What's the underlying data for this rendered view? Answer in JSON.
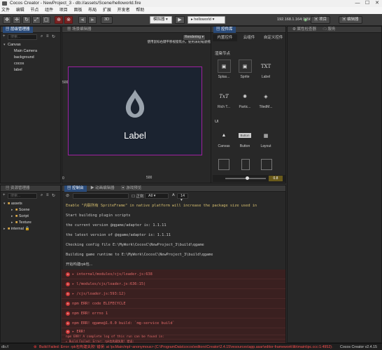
{
  "titlebar": {
    "title": "Cocos Creator - NewProject_3 - db://assets/Scene/helloworld.fire",
    "min": "—",
    "max": "☐",
    "close": "✕"
  },
  "menu": [
    "文件",
    "编辑",
    "节点",
    "组件",
    "项目",
    "面板",
    "布局",
    "扩展",
    "开发者",
    "帮助"
  ],
  "toolbar": {
    "preview_mode": "模拟器",
    "play": "▶",
    "scene_select": "helloworld",
    "ip": "192.168.1.164:7456",
    "project_btn": "项目",
    "editor_btn": "编辑器",
    "label_3d": "3D"
  },
  "hierarchy": {
    "title": "层级管理器",
    "search_placeholder": "搜索...",
    "root": "Canvas",
    "children": [
      "Main Camera",
      "background",
      "cocos",
      "label"
    ]
  },
  "scene": {
    "title": "场景编辑器",
    "hint": "使用鼠标右键平移视窗焦点，使用滚轮缩放视图",
    "label_text": "Label",
    "axis_500_top": "500",
    "axis_500_bottom": "500",
    "axis_0": "0",
    "rendering_btn": "Rendering ▾"
  },
  "controls": {
    "title": "控件库",
    "tabs": [
      "内置控件",
      "云组件",
      "自定义控件"
    ],
    "section_render": "渲染节点",
    "render_items": [
      {
        "label": "Splas...",
        "glyph": "▣"
      },
      {
        "label": "Sprite",
        "glyph": "▣"
      },
      {
        "label": "Label",
        "glyph": "TXT"
      },
      {
        "label": "Rich T...",
        "glyph": "TxT"
      },
      {
        "label": "Partic...",
        "glyph": "✺"
      },
      {
        "label": "TiledM...",
        "glyph": "◈"
      }
    ],
    "section_ui": "UI",
    "ui_items": [
      {
        "label": "Canvas",
        "glyph": "▲"
      },
      {
        "label": "Button",
        "glyph": "Button"
      },
      {
        "label": "Layout",
        "glyph": "▦"
      }
    ],
    "zoom_value": "0.8"
  },
  "inspector": {
    "tabs": [
      "属性检查器",
      "服务"
    ]
  },
  "assets": {
    "title": "资源管理器",
    "search_placeholder": "搜索...",
    "root": "assets",
    "children": [
      "Scene",
      "Script",
      "Texture"
    ],
    "internal": "internal"
  },
  "console": {
    "tabs": [
      "控制台",
      "动画编辑器",
      "游戏预览"
    ],
    "filter_label": "正则",
    "level": "All",
    "font_size": "14",
    "lines": [
      {
        "type": "warn",
        "text": "Enable \"内联所有 SpriteFrame\" in native platform will increase the package size used in"
      },
      {
        "type": "plain",
        "text": "Start building plugin scripts"
      },
      {
        "type": "plain",
        "text": "the current version @qgame/adapter is: 1.1.11"
      },
      {
        "type": "plain",
        "text": "the latest version of @qgame/adapter is: 1.1.11"
      },
      {
        "type": "plain",
        "text": "Checking config file E:\\MyWork\\CocosC\\NewProject_3\\build\\qgame"
      },
      {
        "type": "plain",
        "text": "Building game runtime to E:\\MyWork\\CocosC\\NewProject_3\\build\\qgame"
      },
      {
        "type": "plain",
        "text": "开始构建rpk包..."
      },
      {
        "type": "err",
        "text": "▸ internal/modules/cjs/loader.js:638"
      },
      {
        "type": "err",
        "text": "▸ l/modules/cjs/loader.js:636:15)"
      },
      {
        "type": "err",
        "text": "▸ /cjs/loader.js:593:12)"
      },
      {
        "type": "err",
        "text": "npm ERR! code ELIFECYCLE"
      },
      {
        "type": "err",
        "text": "npm ERR! errno 1"
      },
      {
        "type": "err",
        "text": "npm ERR! qgame@1.0.0 build: `mg-service build`"
      },
      {
        "type": "err",
        "text": "▸ ERR!"
      },
      {
        "type": "err",
        "text": "npm ERR! A complete log of this run can be found in:"
      },
      {
        "type": "err",
        "text": "▸ Build Failed: Error: rpk包构建失败! 错误:"
      }
    ]
  },
  "status": {
    "left": "db://",
    "message": "Build Failed: Error: rpk包构建失败! 错误: at !pcMain/mpl~anonymous> (C:\\ProgramData\\cocos\\editors\\Creator\\2.4.15\\resources\\app.asar\\editor-framework\\lib\\main\\ipc.ccc:1:4952) at",
    "version": "Cocos Creator v2.4.15"
  },
  "colors": {
    "accent": "#2a4b7a",
    "error": "#e36a6a",
    "warn": "#d8c070",
    "scene_border": "#a020a0"
  }
}
